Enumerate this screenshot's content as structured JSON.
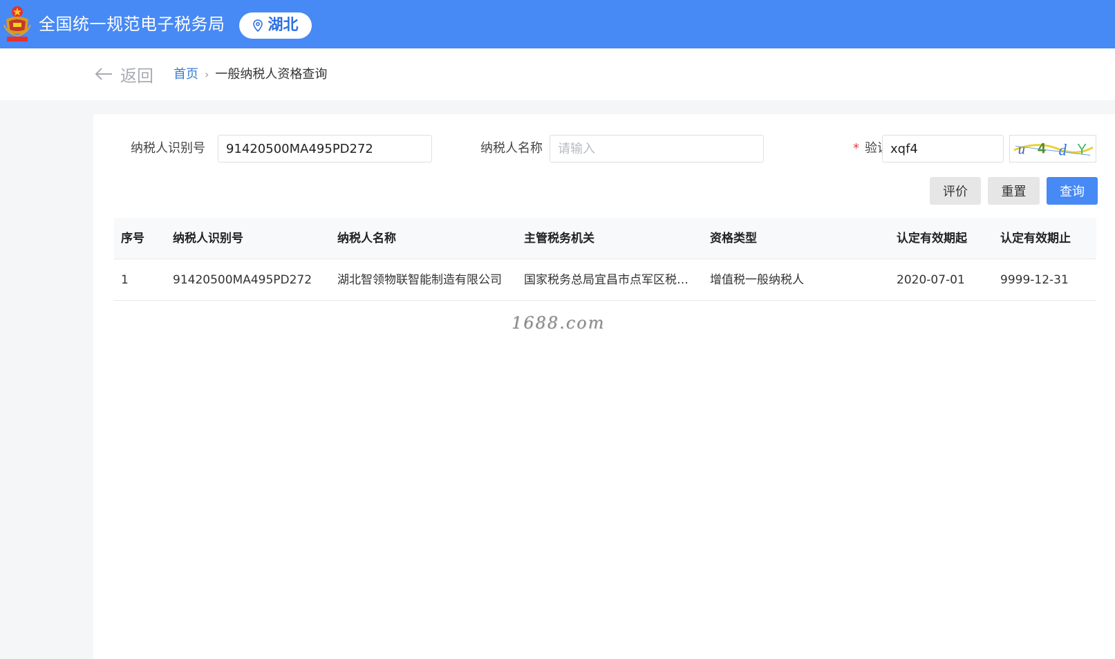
{
  "header": {
    "site_title": "全国统一规范电子税务局",
    "region": "湖北",
    "brand_color": "#4789f5"
  },
  "nav": {
    "back_label": "返回",
    "breadcrumb_home": "首页",
    "breadcrumb_separator": "›",
    "breadcrumb_current": "一般纳税人资格查询"
  },
  "form": {
    "taxpayer_id_label": "纳税人识别号",
    "taxpayer_id_value": "91420500MA495PD272",
    "taxpayer_name_label": "纳税人名称",
    "taxpayer_name_placeholder": "请输入",
    "taxpayer_name_value": "",
    "captcha_required_mark": "*",
    "captcha_label": "验证码",
    "captcha_value": "xqf4",
    "captcha_image_text": "u4dY"
  },
  "actions": {
    "evaluate_label": "评价",
    "reset_label": "重置",
    "query_label": "查询"
  },
  "table": {
    "columns": [
      "序号",
      "纳税人识别号",
      "纳税人名称",
      "主管税务机关",
      "资格类型",
      "认定有效期起",
      "认定有效期止"
    ],
    "rows": [
      [
        "1",
        "91420500MA495PD272",
        "湖北智领物联智能制造有限公司",
        "国家税务总局宜昌市点军区税务局",
        "增值税一般纳税人",
        "2020-07-01",
        "9999-12-31"
      ]
    ]
  },
  "watermark": "1688.com"
}
